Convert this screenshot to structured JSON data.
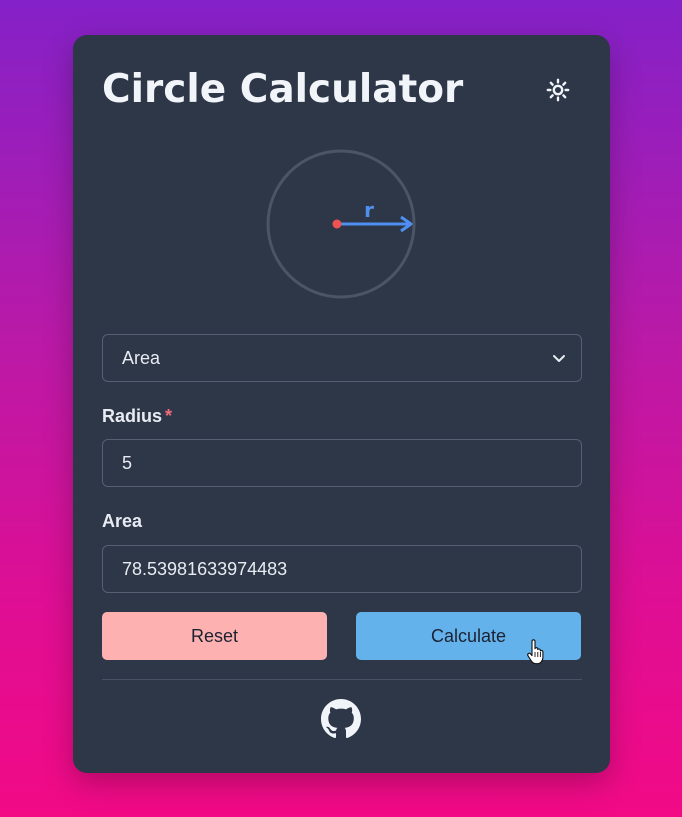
{
  "app": {
    "title": "Circle Calculator",
    "theme_toggle_icon": "sun-icon"
  },
  "diagram": {
    "radius_symbol": "r",
    "colors": {
      "circle": "#4b5565",
      "center": "#ef5350",
      "arrow": "#4f8ff0"
    }
  },
  "calc_select": {
    "selected": "Area",
    "icon": "chevron-down-icon"
  },
  "radius": {
    "label": "Radius",
    "required_marker": "*",
    "value": "5"
  },
  "result": {
    "label": "Area",
    "value": "78.53981633974483"
  },
  "buttons": {
    "reset_label": "Reset",
    "calculate_label": "Calculate"
  },
  "footer": {
    "icon": "github-icon"
  },
  "colors": {
    "card_bg": "#2e3748",
    "reset_bg": "#feb1b1",
    "calculate_bg": "#63b2ec",
    "required": "#f26d7d"
  }
}
